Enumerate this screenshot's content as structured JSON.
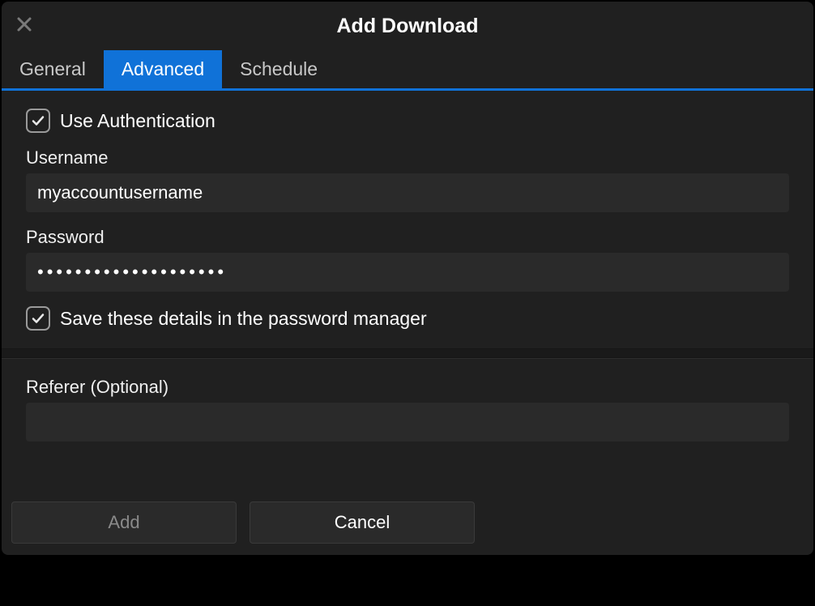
{
  "dialog": {
    "title": "Add Download"
  },
  "tabs": {
    "general": "General",
    "advanced": "Advanced",
    "schedule": "Schedule",
    "active": "advanced"
  },
  "auth": {
    "use_auth_checked": true,
    "use_auth_label": "Use Authentication",
    "username_label": "Username",
    "username_value": "myaccountusername",
    "password_label": "Password",
    "password_value": "••••••••••••••••••••",
    "save_pm_checked": true,
    "save_pm_label": "Save these details in the password manager"
  },
  "referer": {
    "label": "Referer (Optional)",
    "value": ""
  },
  "buttons": {
    "add": "Add",
    "cancel": "Cancel"
  }
}
